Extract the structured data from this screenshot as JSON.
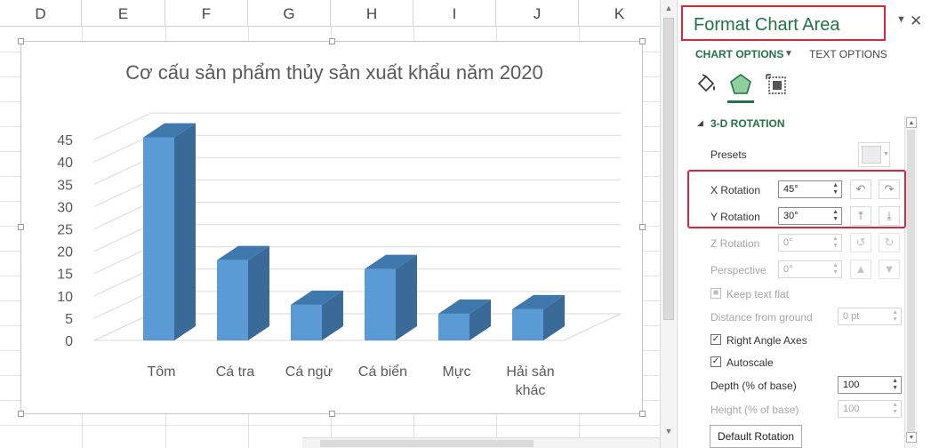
{
  "sheet": {
    "columns": [
      "D",
      "E",
      "F",
      "G",
      "H",
      "I",
      "J",
      "K"
    ]
  },
  "chart": {
    "title": "Cơ cấu sản phẩm thủy sản xuất khẩu năm 2020"
  },
  "chart_data": {
    "type": "bar",
    "title": "Cơ cấu sản phẩm thủy sản xuất khẩu năm 2020",
    "categories": [
      "Tôm",
      "Cá tra",
      "Cá ngừ",
      "Cá biển",
      "Mực",
      "Hải sản khác"
    ],
    "category_lines": [
      [
        "Tôm"
      ],
      [
        "Cá tra"
      ],
      [
        "Cá ngừ"
      ],
      [
        "Cá biển"
      ],
      [
        "Mực"
      ],
      [
        "Hải sản",
        "khác"
      ]
    ],
    "values": [
      45.5,
      18,
      8,
      16,
      6,
      7
    ],
    "ylim": [
      0,
      45
    ],
    "yticks": [
      0,
      5,
      10,
      15,
      20,
      25,
      30,
      35,
      40,
      45
    ],
    "grid": true,
    "colors": {
      "front": "#5b9bd5",
      "side": "#3a6a97",
      "top": "#3f78ac",
      "grid": "#d9d9d9"
    }
  },
  "pane": {
    "title": "Format Chart Area",
    "tab_chart_options": "CHART OPTIONS",
    "tab_text_options": "TEXT OPTIONS",
    "section_title": "3-D ROTATION",
    "presets_label": "Presets",
    "x_rotation_label": "X Rotation",
    "x_rotation_value": "45°",
    "y_rotation_label": "Y Rotation",
    "y_rotation_value": "30°",
    "z_rotation_label": "Z Rotation",
    "z_rotation_value": "0°",
    "perspective_label": "Perspective",
    "perspective_value": "0°",
    "keep_text_flat_label": "Keep text flat",
    "distance_label": "Distance from ground",
    "distance_value": "0 pt",
    "right_angle_axes_label": "Right Angle Axes",
    "autoscale_label": "Autoscale",
    "depth_label": "Depth (% of base)",
    "depth_value": "100",
    "height_label": "Height (% of base)",
    "height_value": "100",
    "default_rotation_label": "Default Rotation",
    "accent_color": "#217346",
    "highlight_color": "#d9263b"
  }
}
